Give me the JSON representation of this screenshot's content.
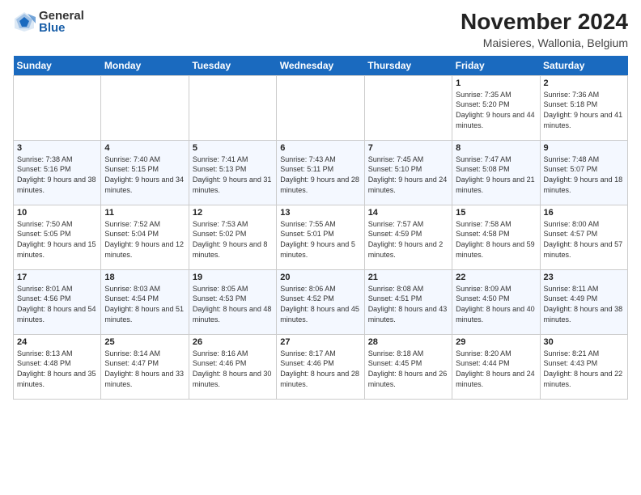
{
  "logo": {
    "general": "General",
    "blue": "Blue"
  },
  "title": "November 2024",
  "subtitle": "Maisieres, Wallonia, Belgium",
  "headers": [
    "Sunday",
    "Monday",
    "Tuesday",
    "Wednesday",
    "Thursday",
    "Friday",
    "Saturday"
  ],
  "weeks": [
    [
      {
        "date": "",
        "info": ""
      },
      {
        "date": "",
        "info": ""
      },
      {
        "date": "",
        "info": ""
      },
      {
        "date": "",
        "info": ""
      },
      {
        "date": "",
        "info": ""
      },
      {
        "date": "1",
        "info": "Sunrise: 7:35 AM\nSunset: 5:20 PM\nDaylight: 9 hours and 44 minutes."
      },
      {
        "date": "2",
        "info": "Sunrise: 7:36 AM\nSunset: 5:18 PM\nDaylight: 9 hours and 41 minutes."
      }
    ],
    [
      {
        "date": "3",
        "info": "Sunrise: 7:38 AM\nSunset: 5:16 PM\nDaylight: 9 hours and 38 minutes."
      },
      {
        "date": "4",
        "info": "Sunrise: 7:40 AM\nSunset: 5:15 PM\nDaylight: 9 hours and 34 minutes."
      },
      {
        "date": "5",
        "info": "Sunrise: 7:41 AM\nSunset: 5:13 PM\nDaylight: 9 hours and 31 minutes."
      },
      {
        "date": "6",
        "info": "Sunrise: 7:43 AM\nSunset: 5:11 PM\nDaylight: 9 hours and 28 minutes."
      },
      {
        "date": "7",
        "info": "Sunrise: 7:45 AM\nSunset: 5:10 PM\nDaylight: 9 hours and 24 minutes."
      },
      {
        "date": "8",
        "info": "Sunrise: 7:47 AM\nSunset: 5:08 PM\nDaylight: 9 hours and 21 minutes."
      },
      {
        "date": "9",
        "info": "Sunrise: 7:48 AM\nSunset: 5:07 PM\nDaylight: 9 hours and 18 minutes."
      }
    ],
    [
      {
        "date": "10",
        "info": "Sunrise: 7:50 AM\nSunset: 5:05 PM\nDaylight: 9 hours and 15 minutes."
      },
      {
        "date": "11",
        "info": "Sunrise: 7:52 AM\nSunset: 5:04 PM\nDaylight: 9 hours and 12 minutes."
      },
      {
        "date": "12",
        "info": "Sunrise: 7:53 AM\nSunset: 5:02 PM\nDaylight: 9 hours and 8 minutes."
      },
      {
        "date": "13",
        "info": "Sunrise: 7:55 AM\nSunset: 5:01 PM\nDaylight: 9 hours and 5 minutes."
      },
      {
        "date": "14",
        "info": "Sunrise: 7:57 AM\nSunset: 4:59 PM\nDaylight: 9 hours and 2 minutes."
      },
      {
        "date": "15",
        "info": "Sunrise: 7:58 AM\nSunset: 4:58 PM\nDaylight: 8 hours and 59 minutes."
      },
      {
        "date": "16",
        "info": "Sunrise: 8:00 AM\nSunset: 4:57 PM\nDaylight: 8 hours and 57 minutes."
      }
    ],
    [
      {
        "date": "17",
        "info": "Sunrise: 8:01 AM\nSunset: 4:56 PM\nDaylight: 8 hours and 54 minutes."
      },
      {
        "date": "18",
        "info": "Sunrise: 8:03 AM\nSunset: 4:54 PM\nDaylight: 8 hours and 51 minutes."
      },
      {
        "date": "19",
        "info": "Sunrise: 8:05 AM\nSunset: 4:53 PM\nDaylight: 8 hours and 48 minutes."
      },
      {
        "date": "20",
        "info": "Sunrise: 8:06 AM\nSunset: 4:52 PM\nDaylight: 8 hours and 45 minutes."
      },
      {
        "date": "21",
        "info": "Sunrise: 8:08 AM\nSunset: 4:51 PM\nDaylight: 8 hours and 43 minutes."
      },
      {
        "date": "22",
        "info": "Sunrise: 8:09 AM\nSunset: 4:50 PM\nDaylight: 8 hours and 40 minutes."
      },
      {
        "date": "23",
        "info": "Sunrise: 8:11 AM\nSunset: 4:49 PM\nDaylight: 8 hours and 38 minutes."
      }
    ],
    [
      {
        "date": "24",
        "info": "Sunrise: 8:13 AM\nSunset: 4:48 PM\nDaylight: 8 hours and 35 minutes."
      },
      {
        "date": "25",
        "info": "Sunrise: 8:14 AM\nSunset: 4:47 PM\nDaylight: 8 hours and 33 minutes."
      },
      {
        "date": "26",
        "info": "Sunrise: 8:16 AM\nSunset: 4:46 PM\nDaylight: 8 hours and 30 minutes."
      },
      {
        "date": "27",
        "info": "Sunrise: 8:17 AM\nSunset: 4:46 PM\nDaylight: 8 hours and 28 minutes."
      },
      {
        "date": "28",
        "info": "Sunrise: 8:18 AM\nSunset: 4:45 PM\nDaylight: 8 hours and 26 minutes."
      },
      {
        "date": "29",
        "info": "Sunrise: 8:20 AM\nSunset: 4:44 PM\nDaylight: 8 hours and 24 minutes."
      },
      {
        "date": "30",
        "info": "Sunrise: 8:21 AM\nSunset: 4:43 PM\nDaylight: 8 hours and 22 minutes."
      }
    ]
  ]
}
